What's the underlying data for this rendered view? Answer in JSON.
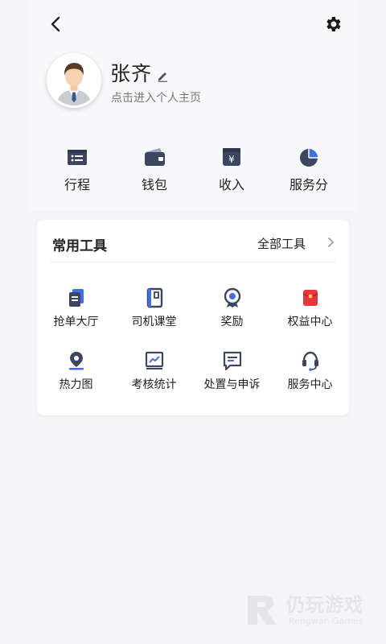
{
  "profile": {
    "name": "张齐",
    "subtitle": "点击进入个人主页"
  },
  "quick_actions": [
    {
      "label": "行程",
      "icon": "itinerary-icon"
    },
    {
      "label": "钱包",
      "icon": "wallet-icon"
    },
    {
      "label": "收入",
      "icon": "income-icon"
    },
    {
      "label": "服务分",
      "icon": "service-score-icon"
    }
  ],
  "tools": {
    "title": "常用工具",
    "all_label": "全部工具",
    "items": [
      {
        "label": "抢单大厅",
        "icon": "order-hall-icon"
      },
      {
        "label": "司机课堂",
        "icon": "driver-class-icon"
      },
      {
        "label": "奖励",
        "icon": "reward-icon"
      },
      {
        "label": "权益中心",
        "icon": "benefits-icon"
      },
      {
        "label": "热力图",
        "icon": "heatmap-icon"
      },
      {
        "label": "考核统计",
        "icon": "stats-icon"
      },
      {
        "label": "处置与申诉",
        "icon": "appeal-icon"
      },
      {
        "label": "服务中心",
        "icon": "service-center-icon"
      }
    ]
  },
  "watermark": {
    "title": "仍玩游戏",
    "subtitle": "Rengwan Games"
  },
  "colors": {
    "icon_dark": "#3d4660",
    "accent_blue": "#3e6ee8",
    "accent_red": "#e8343a"
  }
}
